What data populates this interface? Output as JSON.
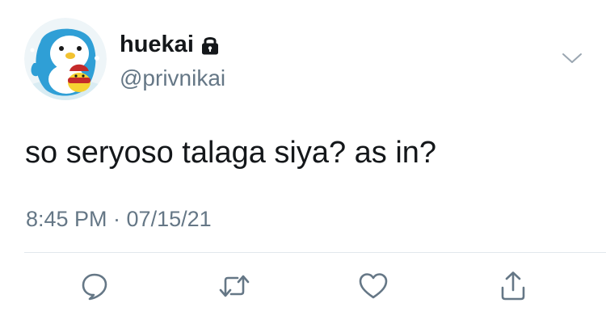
{
  "tweet": {
    "author": {
      "display_name": "huekai",
      "handle": "@privnikai",
      "protected_icon": "lock-icon",
      "avatar": "penguin-avatar"
    },
    "text": "so seryoso talaga siya? as in?",
    "timestamp": "8:45 PM · 07/15/21",
    "menu_icon": "chevron-down-icon"
  },
  "actions": [
    {
      "name": "reply",
      "icon": "speech-bubble-icon"
    },
    {
      "name": "retweet",
      "icon": "retweet-icon"
    },
    {
      "name": "like",
      "icon": "heart-icon"
    },
    {
      "name": "share",
      "icon": "share-upload-icon"
    }
  ],
  "colors": {
    "text_primary": "#14171a",
    "text_secondary": "#657786",
    "divider": "#e1e8ed",
    "icon": "#657786"
  }
}
